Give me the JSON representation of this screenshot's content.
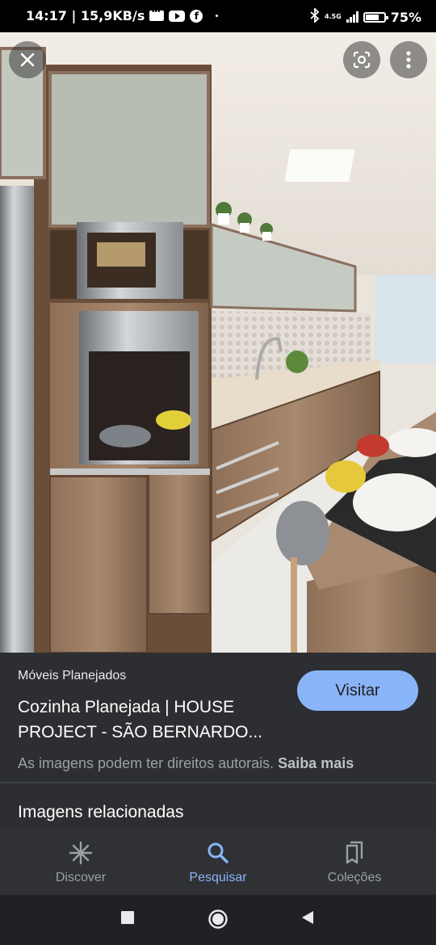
{
  "status_bar": {
    "time_speed": "14:17 | 15,9KB/s",
    "network": "4.5G",
    "battery_level": 0.75,
    "battery_percent": "75%"
  },
  "viewer": {
    "close_icon": "close-icon",
    "lens_icon": "lens-icon",
    "more_icon": "more-vert-icon"
  },
  "result": {
    "source": "Móveis Planejados",
    "title": "Cozinha Planejada | HOUSE\nPROJECT - SÃO BERNARDO...",
    "visit_label": "Visitar",
    "rights_text": "As imagens podem ter direitos autorais.",
    "rights_link": "Saiba mais"
  },
  "related": {
    "heading": "Imagens relacionadas"
  },
  "bottom_nav": {
    "items": [
      {
        "label": "Discover",
        "icon": "asterisk-icon",
        "active": false
      },
      {
        "label": "Pesquisar",
        "icon": "search-icon",
        "active": true
      },
      {
        "label": "Coleções",
        "icon": "collections-icon",
        "active": false
      }
    ]
  },
  "colors": {
    "accent": "#8ab4f8",
    "panel": "#2d2e31",
    "background": "#202124"
  }
}
